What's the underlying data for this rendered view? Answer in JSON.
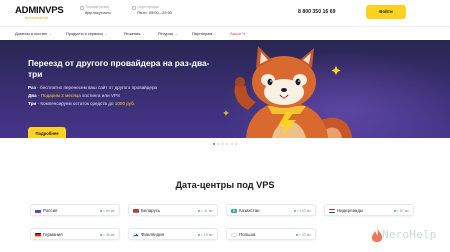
{
  "header": {
    "logo_main": "ADMINVPS",
    "logo_tagline": "все получится!",
    "region": {
      "label": "Текущий регион",
      "value": "Круглосуточно"
    },
    "support": {
      "label": "Отдел продаж",
      "value": "Пн-пт: 09:00—22:00"
    },
    "phone": "8 800 350 16 69",
    "login_label": "Войти"
  },
  "nav": [
    {
      "label": "Домены и хостинг",
      "chevron": true
    },
    {
      "label": "Продукты и сервисы",
      "chevron": true
    },
    {
      "label": "Решения",
      "chevron": true
    },
    {
      "label": "Ресурсы",
      "chevron": true
    },
    {
      "label": "Партнерам",
      "chevron": true
    },
    {
      "label": "Акции %",
      "chevron": false
    }
  ],
  "hero": {
    "title": "Переезд от другого провайдера на раз-два-три",
    "lines": [
      {
        "lead": "Раз",
        "text": " - бесплатно перенесем ваш сайт от другого провайдера",
        "highlight": ""
      },
      {
        "lead": "Два",
        "text": " - ",
        "highlight": "Подарим 2 месяца",
        "tail": " хостинга или VPS"
      },
      {
        "lead": "Три",
        "text": " - Компенсируем остаток средств до ",
        "highlight": "1000 руб.",
        "tail": ""
      }
    ],
    "button_label": "Подробнее"
  },
  "carousel": {
    "count": 6,
    "active": 0
  },
  "section_title": "Дата-центры под VPS",
  "datacenters": [
    {
      "name": "Россия",
      "ping": "≈ 50 мс"
    },
    {
      "name": "Беларусь",
      "ping": "≈ 41 мс"
    },
    {
      "name": "Казахстан",
      "ping": "≈ 103 мс"
    },
    {
      "name": "Нидерланды",
      "ping": "≈ 87 мс"
    },
    {
      "name": "Германия",
      "ping": "≈ 36 мс"
    },
    {
      "name": "Финляндия",
      "ping": "≈ 19 мс"
    },
    {
      "name": "Польша",
      "ping": "≈ 33 мс"
    }
  ],
  "watermark": "NeroHelp",
  "colors": {
    "accent": "#ffd21f",
    "hero": "#3a2f73",
    "sale": "#e0453a",
    "logo_accent": "#f2a900"
  }
}
